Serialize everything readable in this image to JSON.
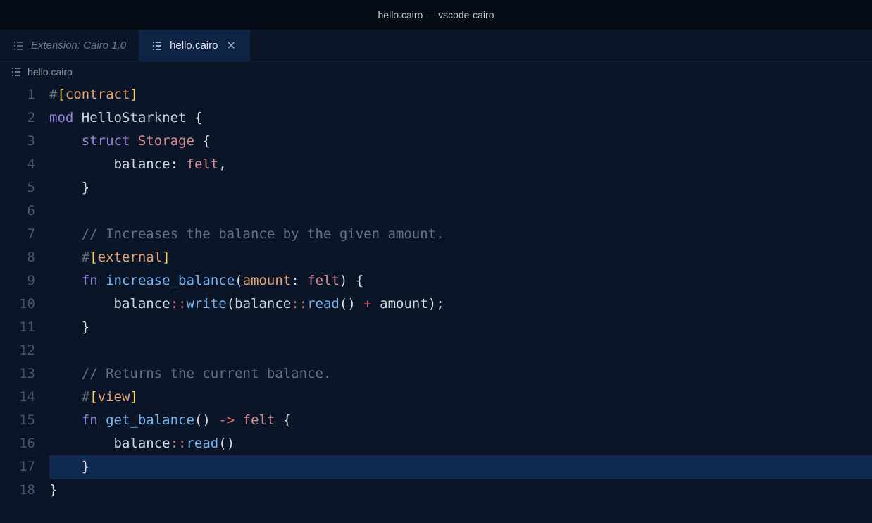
{
  "window": {
    "title": "hello.cairo — vscode-cairo"
  },
  "tabs": [
    {
      "label": "Extension: Cairo 1.0",
      "active": false
    },
    {
      "label": "hello.cairo",
      "active": true
    }
  ],
  "breadcrumb": {
    "file": "hello.cairo"
  },
  "code": {
    "lines": [
      {
        "n": 1,
        "indent": 0,
        "tokens": [
          [
            "attr-hash",
            "#"
          ],
          [
            "bracket",
            "["
          ],
          [
            "ident-call",
            "contract"
          ],
          [
            "bracket",
            "]"
          ]
        ]
      },
      {
        "n": 2,
        "indent": 0,
        "tokens": [
          [
            "kw",
            "mod"
          ],
          [
            "default",
            " "
          ],
          [
            "typename",
            "HelloStarknet"
          ],
          [
            "default",
            " "
          ],
          [
            "punct",
            "{"
          ]
        ]
      },
      {
        "n": 3,
        "indent": 1,
        "guides": [
          0
        ],
        "tokens": [
          [
            "kw",
            "struct"
          ],
          [
            "default",
            " "
          ],
          [
            "type",
            "Storage"
          ],
          [
            "default",
            " "
          ],
          [
            "punct",
            "{"
          ]
        ]
      },
      {
        "n": 4,
        "indent": 2,
        "guides": [
          0,
          1
        ],
        "tokens": [
          [
            "default",
            "balance"
          ],
          [
            "punct",
            ":"
          ],
          [
            "default",
            " "
          ],
          [
            "type",
            "felt"
          ],
          [
            "punct",
            ","
          ]
        ]
      },
      {
        "n": 5,
        "indent": 1,
        "guides": [
          0
        ],
        "tokens": [
          [
            "punct",
            "}"
          ]
        ]
      },
      {
        "n": 6,
        "indent": 0,
        "guides": [
          0
        ],
        "tokens": []
      },
      {
        "n": 7,
        "indent": 1,
        "guides": [
          0
        ],
        "tokens": [
          [
            "comment",
            "// Increases the balance by the given amount."
          ]
        ]
      },
      {
        "n": 8,
        "indent": 1,
        "guides": [
          0
        ],
        "tokens": [
          [
            "attr-hash",
            "#"
          ],
          [
            "bracket",
            "["
          ],
          [
            "ident-call",
            "external"
          ],
          [
            "bracket",
            "]"
          ]
        ]
      },
      {
        "n": 9,
        "indent": 1,
        "guides": [
          0
        ],
        "tokens": [
          [
            "kw2",
            "fn"
          ],
          [
            "default",
            " "
          ],
          [
            "fn",
            "increase_balance"
          ],
          [
            "punct",
            "("
          ],
          [
            "param",
            "amount"
          ],
          [
            "punct",
            ":"
          ],
          [
            "default",
            " "
          ],
          [
            "type",
            "felt"
          ],
          [
            "punct",
            ")"
          ],
          [
            "default",
            " "
          ],
          [
            "punct",
            "{"
          ]
        ]
      },
      {
        "n": 10,
        "indent": 2,
        "guides": [
          0,
          1
        ],
        "tokens": [
          [
            "default",
            "balance"
          ],
          [
            "op",
            "::"
          ],
          [
            "fn",
            "write"
          ],
          [
            "punct",
            "("
          ],
          [
            "default",
            "balance"
          ],
          [
            "op",
            "::"
          ],
          [
            "fn",
            "read"
          ],
          [
            "punct",
            "()"
          ],
          [
            "default",
            " "
          ],
          [
            "op",
            "+"
          ],
          [
            "default",
            " "
          ],
          [
            "default",
            "amount"
          ],
          [
            "punct",
            ")"
          ],
          [
            "punct",
            ";"
          ]
        ]
      },
      {
        "n": 11,
        "indent": 1,
        "guides": [
          0
        ],
        "tokens": [
          [
            "punct",
            "}"
          ]
        ]
      },
      {
        "n": 12,
        "indent": 0,
        "guides": [
          0
        ],
        "tokens": []
      },
      {
        "n": 13,
        "indent": 1,
        "guides": [
          0
        ],
        "tokens": [
          [
            "comment",
            "// Returns the current balance."
          ]
        ]
      },
      {
        "n": 14,
        "indent": 1,
        "guides": [
          0
        ],
        "tokens": [
          [
            "attr-hash",
            "#"
          ],
          [
            "bracket",
            "["
          ],
          [
            "ident-call",
            "view"
          ],
          [
            "bracket",
            "]"
          ]
        ]
      },
      {
        "n": 15,
        "indent": 1,
        "guides": [
          0
        ],
        "tokens": [
          [
            "kw2",
            "fn"
          ],
          [
            "default",
            " "
          ],
          [
            "fn",
            "get_balance"
          ],
          [
            "punct",
            "()"
          ],
          [
            "default",
            " "
          ],
          [
            "op",
            "->"
          ],
          [
            "default",
            " "
          ],
          [
            "type",
            "felt"
          ],
          [
            "default",
            " "
          ],
          [
            "punct",
            "{"
          ]
        ]
      },
      {
        "n": 16,
        "indent": 2,
        "guides": [
          0,
          1
        ],
        "tokens": [
          [
            "default",
            "balance"
          ],
          [
            "op",
            "::"
          ],
          [
            "fn",
            "read"
          ],
          [
            "punct",
            "()"
          ]
        ]
      },
      {
        "n": 17,
        "indent": 1,
        "guides": [
          0
        ],
        "tokens": [
          [
            "punct",
            "}"
          ]
        ],
        "highlight": true
      },
      {
        "n": 18,
        "indent": 0,
        "tokens": [
          [
            "punct",
            "}"
          ]
        ]
      }
    ]
  }
}
